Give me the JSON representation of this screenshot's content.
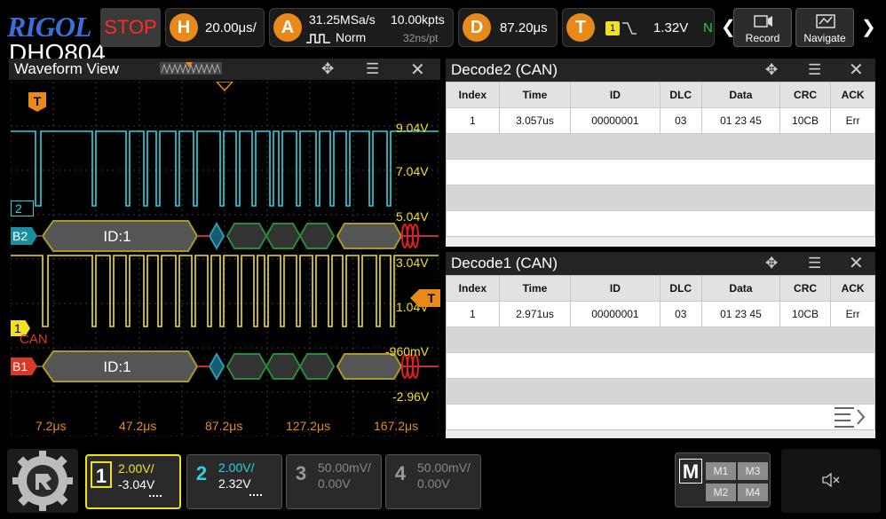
{
  "brand": {
    "logo": "RIGOL",
    "model": "DHO804"
  },
  "top": {
    "run_state": "STOP",
    "horizontal": {
      "badge": "H",
      "value": "20.00μs/"
    },
    "acquire": {
      "badge": "A",
      "rate": "31.25MSa/s",
      "points": "10.00kpts",
      "mode": "Norm",
      "sample": "32ns/pt"
    },
    "delay": {
      "badge": "D",
      "value": "87.20μs"
    },
    "trigger": {
      "badge": "T",
      "channel": "1",
      "level": "1.32V",
      "mode": "N"
    },
    "record_label": "Record",
    "navigate_label": "Navigate"
  },
  "waveform": {
    "title": "Waveform View",
    "trigger_marker": "T",
    "voltage_labels": [
      "9.04V",
      "7.04V",
      "5.04V",
      "3.04V",
      "1.04V",
      "-960mV",
      "-2.96V"
    ],
    "time_labels": [
      "7.2μs",
      "47.2μs",
      "87.2μs",
      "127.2μs",
      "167.2μs"
    ],
    "ch2_tag": "2",
    "ch1_tag": "1",
    "bus2_tag": "B2",
    "bus1_tag": "B1",
    "can_label": "CAN",
    "bus2_frame": "ID:1",
    "bus1_frame": "ID:1",
    "trigger_level_tag": "T"
  },
  "decode2": {
    "title": "Decode2 (CAN)",
    "columns": [
      "Index",
      "Time",
      "ID",
      "DLC",
      "Data",
      "CRC",
      "ACK"
    ],
    "rows": [
      [
        "1",
        "3.057us",
        "00000001",
        "03",
        "01 23 45",
        "10CB",
        "Err"
      ]
    ]
  },
  "decode1": {
    "title": "Decode1 (CAN)",
    "columns": [
      "Index",
      "Time",
      "ID",
      "DLC",
      "Data",
      "CRC",
      "ACK"
    ],
    "rows": [
      [
        "1",
        "2.971us",
        "00000001",
        "03",
        "01 23 45",
        "10CB",
        "Err"
      ]
    ]
  },
  "channels": [
    {
      "num": "1",
      "scale": "2.00V/",
      "offset": "-3.04V",
      "color": "#f0e020"
    },
    {
      "num": "2",
      "scale": "2.00V/",
      "offset": "2.32V",
      "color": "#2ad4e4"
    },
    {
      "num": "3",
      "scale": "50.00mV/",
      "offset": "0.00V",
      "color": "#888888"
    },
    {
      "num": "4",
      "scale": "50.00mV/",
      "offset": "0.00V",
      "color": "#888888"
    }
  ],
  "math": {
    "badge": "M",
    "m1": "M1",
    "m2": "M2",
    "m3": "M3",
    "m4": "M4"
  },
  "colors": {
    "ch1": "#f0e020",
    "ch2": "#2ad4e4",
    "bus2": "#1a8fa0",
    "bus1": "#d83a2a",
    "accent": "#e8891a"
  }
}
